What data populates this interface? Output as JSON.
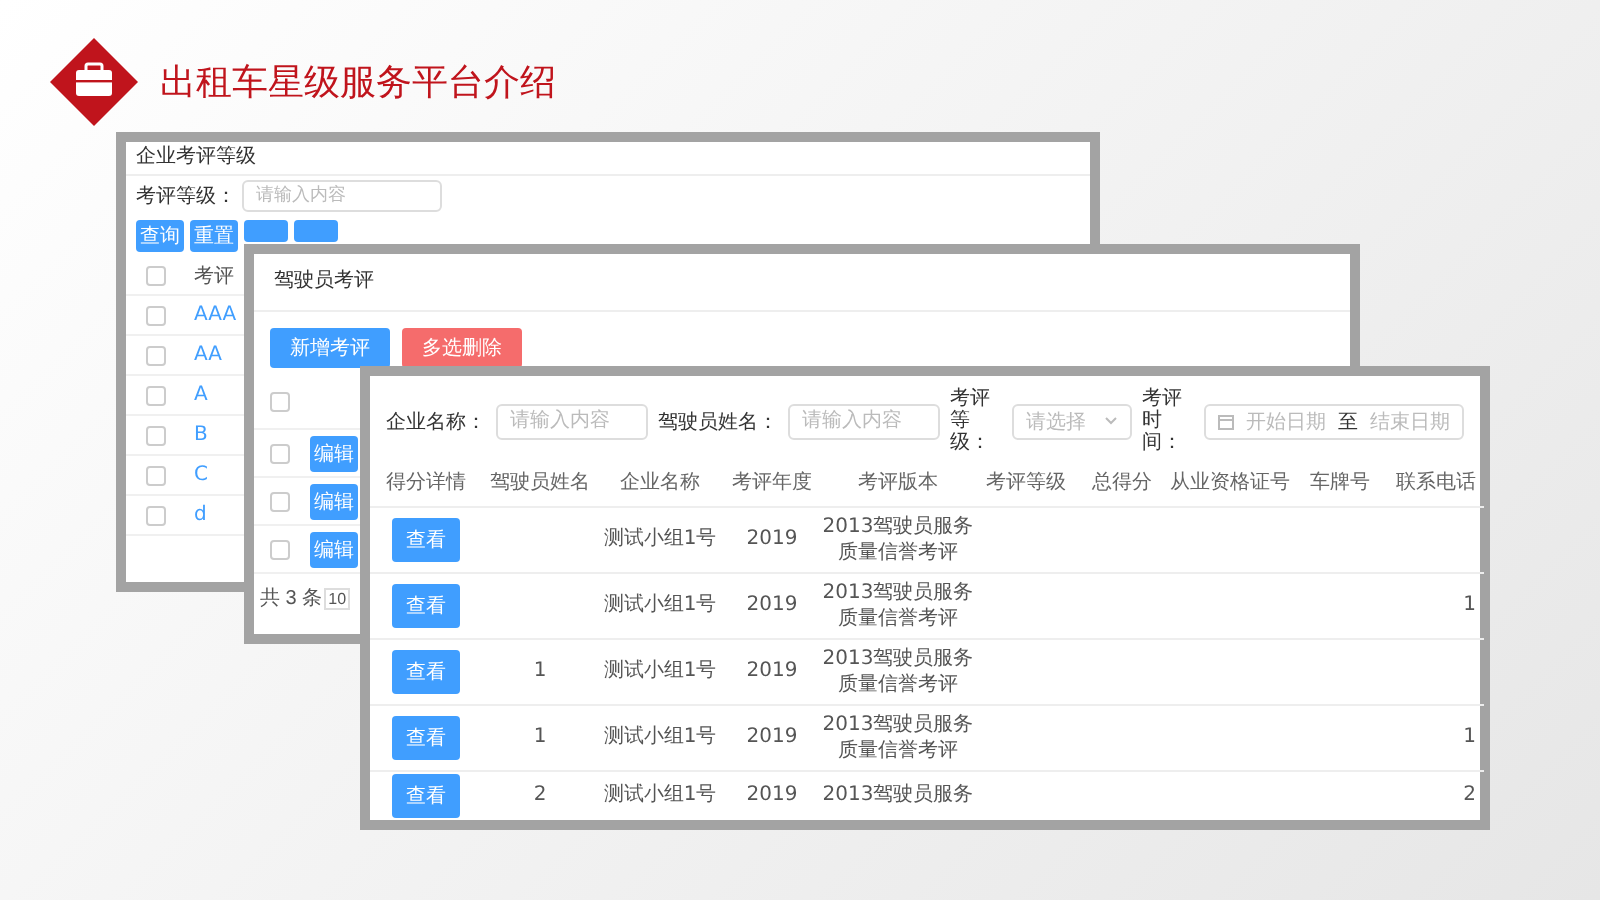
{
  "slide": {
    "title": "出租车星级服务平台介绍"
  },
  "back_window": {
    "title": "企业考评等级",
    "filter": {
      "label": "考评等级：",
      "placeholder": "请输入内容"
    },
    "buttons": [
      "查询",
      "重置"
    ],
    "header_checked": false,
    "column": "考评",
    "rows": [
      {
        "checked": false,
        "grade": "AAA"
      },
      {
        "checked": false,
        "grade": "AA"
      },
      {
        "checked": false,
        "grade": "A"
      },
      {
        "checked": false,
        "grade": "B"
      },
      {
        "checked": false,
        "grade": "C"
      },
      {
        "checked": false,
        "grade": "d"
      }
    ]
  },
  "middle_window": {
    "title": "驾驶员考评",
    "buttons": [
      {
        "label": "新增考评",
        "kind": "primary"
      },
      {
        "label": "多选删除",
        "kind": "danger"
      }
    ],
    "header_checked": false,
    "rows": [
      {
        "checked": false,
        "action": "编辑"
      },
      {
        "checked": false,
        "action": "编辑"
      },
      {
        "checked": false,
        "action": "编辑"
      }
    ],
    "pagination": {
      "total": "共 3 条",
      "page_size": "10"
    }
  },
  "front_window": {
    "filters": [
      {
        "kind": "input",
        "label": "企业名称：",
        "placeholder": "请输入内容"
      },
      {
        "kind": "input",
        "label": "驾驶员姓名：",
        "placeholder": "请输入内容"
      },
      {
        "kind": "select",
        "label": "考评等级：",
        "placeholder": "请选择"
      },
      {
        "kind": "daterange",
        "label": "考评时间：",
        "start_placeholder": "开始日期",
        "separator": "至",
        "end_placeholder": "结束日期"
      }
    ],
    "columns": [
      "得分详情",
      "驾驶员姓名",
      "企业名称",
      "考评年度",
      "考评版本",
      "考评等级",
      "总得分",
      "从业资格证号",
      "车牌号",
      "联系电话"
    ],
    "rows": [
      {
        "action": "查看",
        "driver": "",
        "company": "测试小组1号",
        "year": "2019",
        "version": "2013驾驶员服务质量信誉考评",
        "phone": ""
      },
      {
        "action": "查看",
        "driver": "",
        "company": "测试小组1号",
        "year": "2019",
        "version": "2013驾驶员服务质量信誉考评",
        "phone": "1"
      },
      {
        "action": "查看",
        "driver": "1",
        "company": "测试小组1号",
        "year": "2019",
        "version": "2013驾驶员服务质量信誉考评",
        "phone": ""
      },
      {
        "action": "查看",
        "driver": "1",
        "company": "测试小组1号",
        "year": "2019",
        "version": "2013驾驶员服务质量信誉考评",
        "phone": "1"
      },
      {
        "action": "查看",
        "driver": "2",
        "company": "测试小组1号",
        "year": "2019",
        "version": "2013驾驶员服务",
        "phone": "2"
      }
    ]
  }
}
